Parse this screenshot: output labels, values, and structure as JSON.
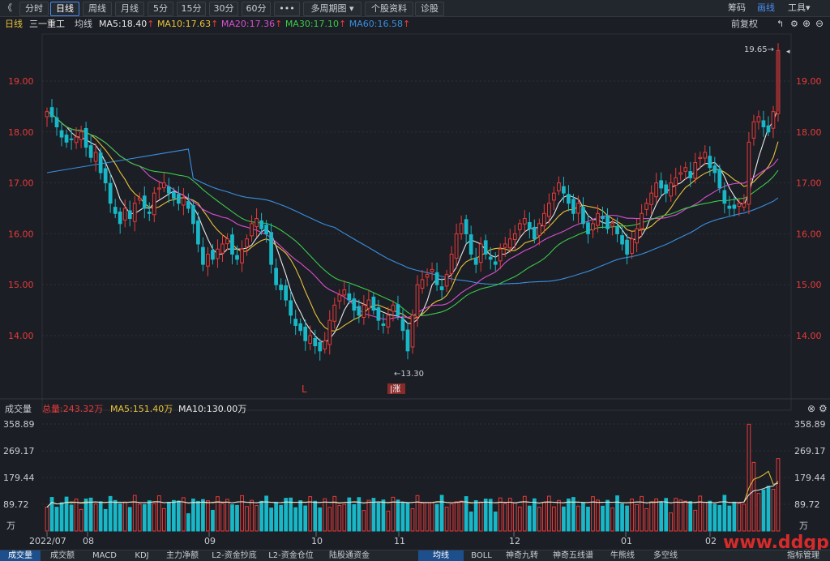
{
  "toolbar": {
    "back": "《",
    "tabs": [
      "分时",
      "日线",
      "周线",
      "月线",
      "5分",
      "15分",
      "30分",
      "60分",
      "•••",
      "多周期图",
      "个股资料",
      "诊股"
    ],
    "active_tab": "日线",
    "right": [
      "筹码",
      "画线",
      "工具"
    ]
  },
  "info_bar": {
    "period": "日线",
    "stock": "三一重工",
    "avg_label": "均线",
    "ma": [
      {
        "label": "MA5:18.40",
        "arrow": "↑",
        "color": "#e8e8e8"
      },
      {
        "label": "MA10:17.63",
        "arrow": "↑",
        "color": "#e8c23a"
      },
      {
        "label": "MA20:17.36",
        "arrow": "↑",
        "color": "#d94fd1"
      },
      {
        "label": "MA30:17.10",
        "arrow": "↑",
        "color": "#3cc94a"
      },
      {
        "label": "MA60:16.58",
        "arrow": "↑",
        "color": "#3a8fe0"
      }
    ],
    "adjust": "前复权"
  },
  "price_panel": {
    "y_ticks": [
      "19.00",
      "18.00",
      "17.00",
      "16.00",
      "15.00",
      "14.00"
    ],
    "y_values": [
      19,
      18,
      17,
      16,
      15,
      14
    ],
    "high_label": "19.65→",
    "low_label": "←13.30",
    "marker_L": "L",
    "marker_zhang": "涨"
  },
  "volume_panel": {
    "title": "成交量",
    "total": "总量:243.32万",
    "ma5": "MA5:151.40万",
    "ma10": "MA10:130.00万",
    "y_ticks": [
      "358.89",
      "269.17",
      "179.44",
      "89.72"
    ],
    "y_values": [
      358.89,
      269.17,
      179.44,
      89.72
    ],
    "unit": "万"
  },
  "x_labels": [
    "2022/07",
    "08",
    "09",
    "10",
    "11",
    "12",
    "01",
    "02"
  ],
  "bottom_tabs": [
    "成交量",
    "成交额",
    "MACD",
    "KDJ",
    "主力净额",
    "L2-资金抄底",
    "L2-资金仓位",
    "陆股通资金",
    "均线",
    "BOLL",
    "神奇九转",
    "神奇五线谱",
    "牛熊线",
    "多空线"
  ],
  "bottom_right": "指标管理",
  "watermark": "www.ddgp.net",
  "colors": {
    "up": "#e83a3a",
    "down": "#19b8c8",
    "bg": "#1b1e24",
    "grid": "#2c3038"
  },
  "chart_data": {
    "type": "candlestick",
    "title": "三一重工 日线",
    "x_range": [
      "2022/07",
      "2023/02"
    ],
    "y_range": [
      13.3,
      19.65
    ],
    "series": [
      {
        "name": "MA5",
        "last": 18.4
      },
      {
        "name": "MA10",
        "last": 17.63
      },
      {
        "name": "MA20",
        "last": 17.36
      },
      {
        "name": "MA30",
        "last": 17.1
      },
      {
        "name": "MA60",
        "last": 16.58
      }
    ],
    "highest": 19.65,
    "lowest": 13.3,
    "closes": [
      18.4,
      18.3,
      18.1,
      17.9,
      17.8,
      17.85,
      17.9,
      18.0,
      17.7,
      17.5,
      17.6,
      17.2,
      17.0,
      16.6,
      16.4,
      16.2,
      16.5,
      16.3,
      16.6,
      16.7,
      16.5,
      16.4,
      16.8,
      16.9,
      17.0,
      16.8,
      16.7,
      16.6,
      16.7,
      16.5,
      16.2,
      15.8,
      15.4,
      15.6,
      15.5,
      15.7,
      15.8,
      15.9,
      15.6,
      15.5,
      15.7,
      15.9,
      16.2,
      16.3,
      16.1,
      16.0,
      15.4,
      15.0,
      14.9,
      14.7,
      14.4,
      14.2,
      14.1,
      13.9,
      14.0,
      13.8,
      13.7,
      13.9,
      14.3,
      14.6,
      14.8,
      14.9,
      14.7,
      14.5,
      14.4,
      14.6,
      14.7,
      14.5,
      14.3,
      14.2,
      14.4,
      14.6,
      14.4,
      14.1,
      13.7,
      14.4,
      15.0,
      15.1,
      15.2,
      15.3,
      15.0,
      14.9,
      15.2,
      15.6,
      16.0,
      16.2,
      16.0,
      15.6,
      15.4,
      15.8,
      15.6,
      15.5,
      15.4,
      15.7,
      15.8,
      15.9,
      16.0,
      16.2,
      16.3,
      16.1,
      15.9,
      16.2,
      16.4,
      16.6,
      16.8,
      17.0,
      16.8,
      16.6,
      16.4,
      16.6,
      16.2,
      16.0,
      16.2,
      16.4,
      16.3,
      16.1,
      16.2,
      16.0,
      15.8,
      15.6,
      15.9,
      16.1,
      16.4,
      16.6,
      16.8,
      17.0,
      16.9,
      16.8,
      17.0,
      17.1,
      17.2,
      17.3,
      17.1,
      17.4,
      17.5,
      17.6,
      17.3,
      17.2,
      16.9,
      16.6,
      16.5,
      16.5,
      16.6,
      16.6,
      17.8,
      18.2,
      18.3,
      18.1,
      18.0,
      18.4,
      19.6
    ],
    "volume": {
      "last_total": 243.32,
      "ma5": 151.4,
      "ma10": 130.0,
      "max": 358.89
    }
  }
}
